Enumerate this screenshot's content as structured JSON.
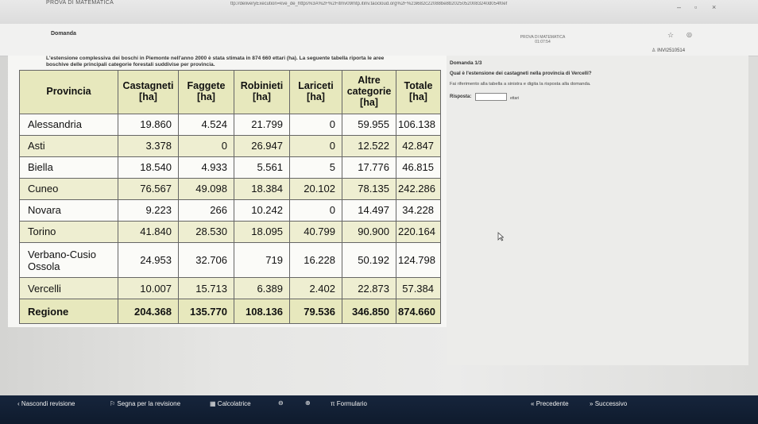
{
  "window": {
    "title": "PROVA DI MATEMATICA",
    "url": "ttp://deliveryExecution=kve_de_https%3A%2F%2Fitmv09mtp.itinv.taocloud.org%2F%23i682c22088be8b20250520083240d054f0ef"
  },
  "edge_labels": [
    "50",
    "13"
  ],
  "header": {
    "section": "Domanda",
    "test_name": "PROVA DI MATEMATICA",
    "timer": "01:07:54",
    "user": "INVI2510514"
  },
  "intro": {
    "line1": "L'estensione complessiva dei boschi in Piemonte nell'anno 2000 è stata stimata in  874 660 ettari (ha). La seguente tabella riporta le aree",
    "line2": "boschive delle principali categorie forestali suddivise per provincia."
  },
  "table": {
    "headers": [
      "Provincia",
      "Castagneti [ha]",
      "Faggete [ha]",
      "Robinieti [ha]",
      "Lariceti [ha]",
      "Altre categorie [ha]",
      "Totale [ha]"
    ],
    "rows": [
      [
        "Alessandria",
        "19.860",
        "4.524",
        "21.799",
        "0",
        "59.955",
        "106.138"
      ],
      [
        "Asti",
        "3.378",
        "0",
        "26.947",
        "0",
        "12.522",
        "42.847"
      ],
      [
        "Biella",
        "18.540",
        "4.933",
        "5.561",
        "5",
        "17.776",
        "46.815"
      ],
      [
        "Cuneo",
        "76.567",
        "49.098",
        "18.384",
        "20.102",
        "78.135",
        "242.286"
      ],
      [
        "Novara",
        "9.223",
        "266",
        "10.242",
        "0",
        "14.497",
        "34.228"
      ],
      [
        "Torino",
        "41.840",
        "28.530",
        "18.095",
        "40.799",
        "90.900",
        "220.164"
      ],
      [
        "Verbano-Cusio Ossola",
        "24.953",
        "32.706",
        "719",
        "16.228",
        "50.192",
        "124.798"
      ],
      [
        "Vercelli",
        "10.007",
        "15.713",
        "6.389",
        "2.402",
        "22.873",
        "57.384"
      ]
    ],
    "total": [
      "Regione",
      "204.368",
      "135.770",
      "108.136",
      "79.536",
      "346.850",
      "874.660"
    ]
  },
  "question": {
    "counter": "Domanda 1/3",
    "text": "Qual è l'estensione dei castagneti nella provincia di Vercelli?",
    "hint": "Fai riferimento alla tabella a sinistra e digita la risposta alla domanda.",
    "answer_label": "Risposta:",
    "answer_value": "",
    "answer_unit": "ettari"
  },
  "footer": {
    "hide_review": "Nascondi revisione",
    "mark_review": "Segna per la revisione",
    "calculator": "Calcolatrice",
    "formulary": "Formulario",
    "previous": "Precedente",
    "next": "Successivo"
  }
}
